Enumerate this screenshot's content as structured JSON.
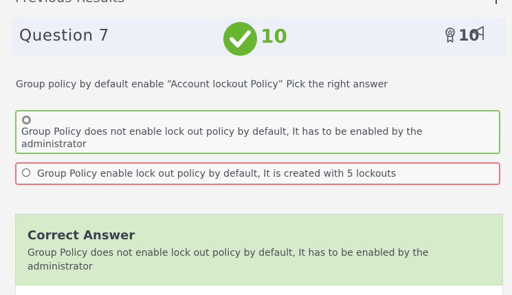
{
  "header": {
    "previous_results": "Previous Results"
  },
  "question": {
    "title": "Question 7",
    "score": "10",
    "points": "10",
    "text": "Group policy by default enable  “Account lockout Policy” Pick the right answer",
    "status_icon": "check-circle-icon",
    "points_icon": "ribbon-icon",
    "flag_icon": "flag-icon"
  },
  "options": [
    {
      "label": "Group Policy does not enable lock out policy by default, It has to be enabled by the administrator",
      "state": "correct",
      "selected": true
    },
    {
      "label": "Group Policy enable lock out policy by default, It is created with 5 lockouts",
      "state": "incorrect",
      "selected": false
    }
  ],
  "answer": {
    "title": "Correct Answer",
    "text": "Group Policy does not enable lock out policy by default, It has to be enabled by the administrator"
  },
  "colors": {
    "accent_green": "#68b630",
    "correct_border": "#86c26a",
    "wrong_border": "#e9777f",
    "answer_bg": "#d6ebc9",
    "header_bg": "#eef0f7"
  }
}
